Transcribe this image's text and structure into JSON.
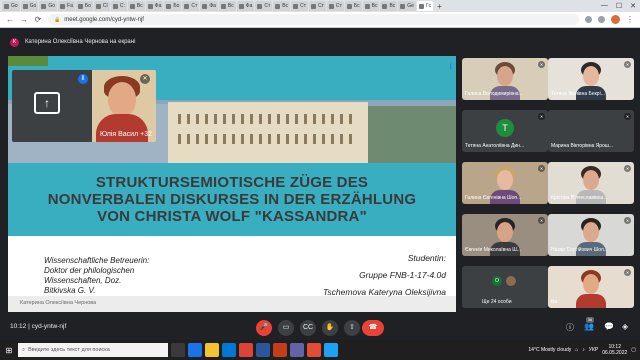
{
  "browser": {
    "tabs": [
      "Go",
      "Go",
      "Go",
      "Fa",
      "Бо",
      "Cl",
      "С:",
      "Вс",
      "Фа",
      "Бо",
      "Ст",
      "Фа",
      "Вс",
      "Фа",
      "Ст",
      "Вс",
      "Ст",
      "Ст",
      "Ст",
      "Бс",
      "Вс",
      "Вс",
      "Ge",
      "Гс"
    ],
    "new_tab": "+",
    "url": "meet.google.com/cyd-yntw-njf"
  },
  "banner": {
    "avatar_letter": "К",
    "text": "Катерина Олексіївна Чернова на екрані"
  },
  "slide": {
    "title_lines": [
      "STRUKTURSEMIOTISCHE ZÜGE DES",
      "NONVERBALEN DISKURSES IN DER ERZÄHLUNG",
      "VON CHRISTA WOLF \"KASSANDRA\""
    ],
    "supervisor_lines": [
      "Wissenschaftliche Betreuerin:",
      "Doktor der philologischen",
      "Wissenschaften, Doz.",
      "Bitkivska G. V."
    ],
    "student_lines": [
      "Studentin:",
      "Gruppe FNB-1-17-4.0d",
      "Tschemova Kateryna Oleksijivna"
    ],
    "presenter_name": "Катерина Олексіївна Чернова"
  },
  "self_tile": {
    "label": "Юлія Васил  +32"
  },
  "participants": [
    {
      "name": "Галина Володимирівна...",
      "type": "photo",
      "bg": "#d8cdb8",
      "skin": "#d9a58a",
      "hair": "#6b4a3a",
      "top": "#7a6a8a"
    },
    {
      "name": "Тетяна Іванівна Бекрі...",
      "type": "photo",
      "bg": "#e6e2da",
      "skin": "#e5b79c",
      "hair": "#2a2a2a",
      "top": "#2f3a4a"
    },
    {
      "name": "Тетяна Анатоліївна Дин...",
      "type": "letter",
      "letter": "T"
    },
    {
      "name": "Марина Вікторівна Ярош...",
      "type": "blank"
    },
    {
      "name": "Галина Євгенівна Шоп...",
      "type": "photo",
      "bg": "#b8a58a",
      "skin": "#e6b9a0",
      "hair": "#c9a56a",
      "top": "#6e4a7a"
    },
    {
      "name": "Крістіна Вʼячеславівна...",
      "type": "photo",
      "bg": "#e2ddd2",
      "skin": "#dba98e",
      "hair": "#3a2a20",
      "top": "#b8b8b8"
    },
    {
      "name": "Євгенія Миколаївна Ш...",
      "type": "photo",
      "bg": "#9a8e80",
      "skin": "#d6a386",
      "hair": "#2a2420",
      "top": "#3a3a3a"
    },
    {
      "name": "Назар Сергійович Шоп...",
      "type": "photo",
      "bg": "#d8d8d6",
      "skin": "#dba98e",
      "hair": "#2a2420",
      "top": "#5a6a7a"
    },
    {
      "name": "Ще 24 особи",
      "type": "others",
      "letter": "O"
    },
    {
      "name": "Ви",
      "type": "photo",
      "bg": "#e6ddd0",
      "skin": "#e2a987",
      "hair": "#8a3a22",
      "top": "#b23a2e"
    }
  ],
  "controls": {
    "meeting_time": "10:12",
    "meeting_code": "cyd-yntw-njf",
    "participant_badge": "36"
  },
  "taskbar": {
    "search_placeholder": "Введите здесь текст для поиска",
    "weather": "14°C  Mostly cloudy",
    "language": "УКР",
    "time": "10:12",
    "date": "06.05.2022"
  },
  "colors": {
    "slide_teal": "#3aaec1",
    "meet_dark": "#202124",
    "hangup_red": "#ea4335",
    "accent_blue": "#1a73e8"
  }
}
